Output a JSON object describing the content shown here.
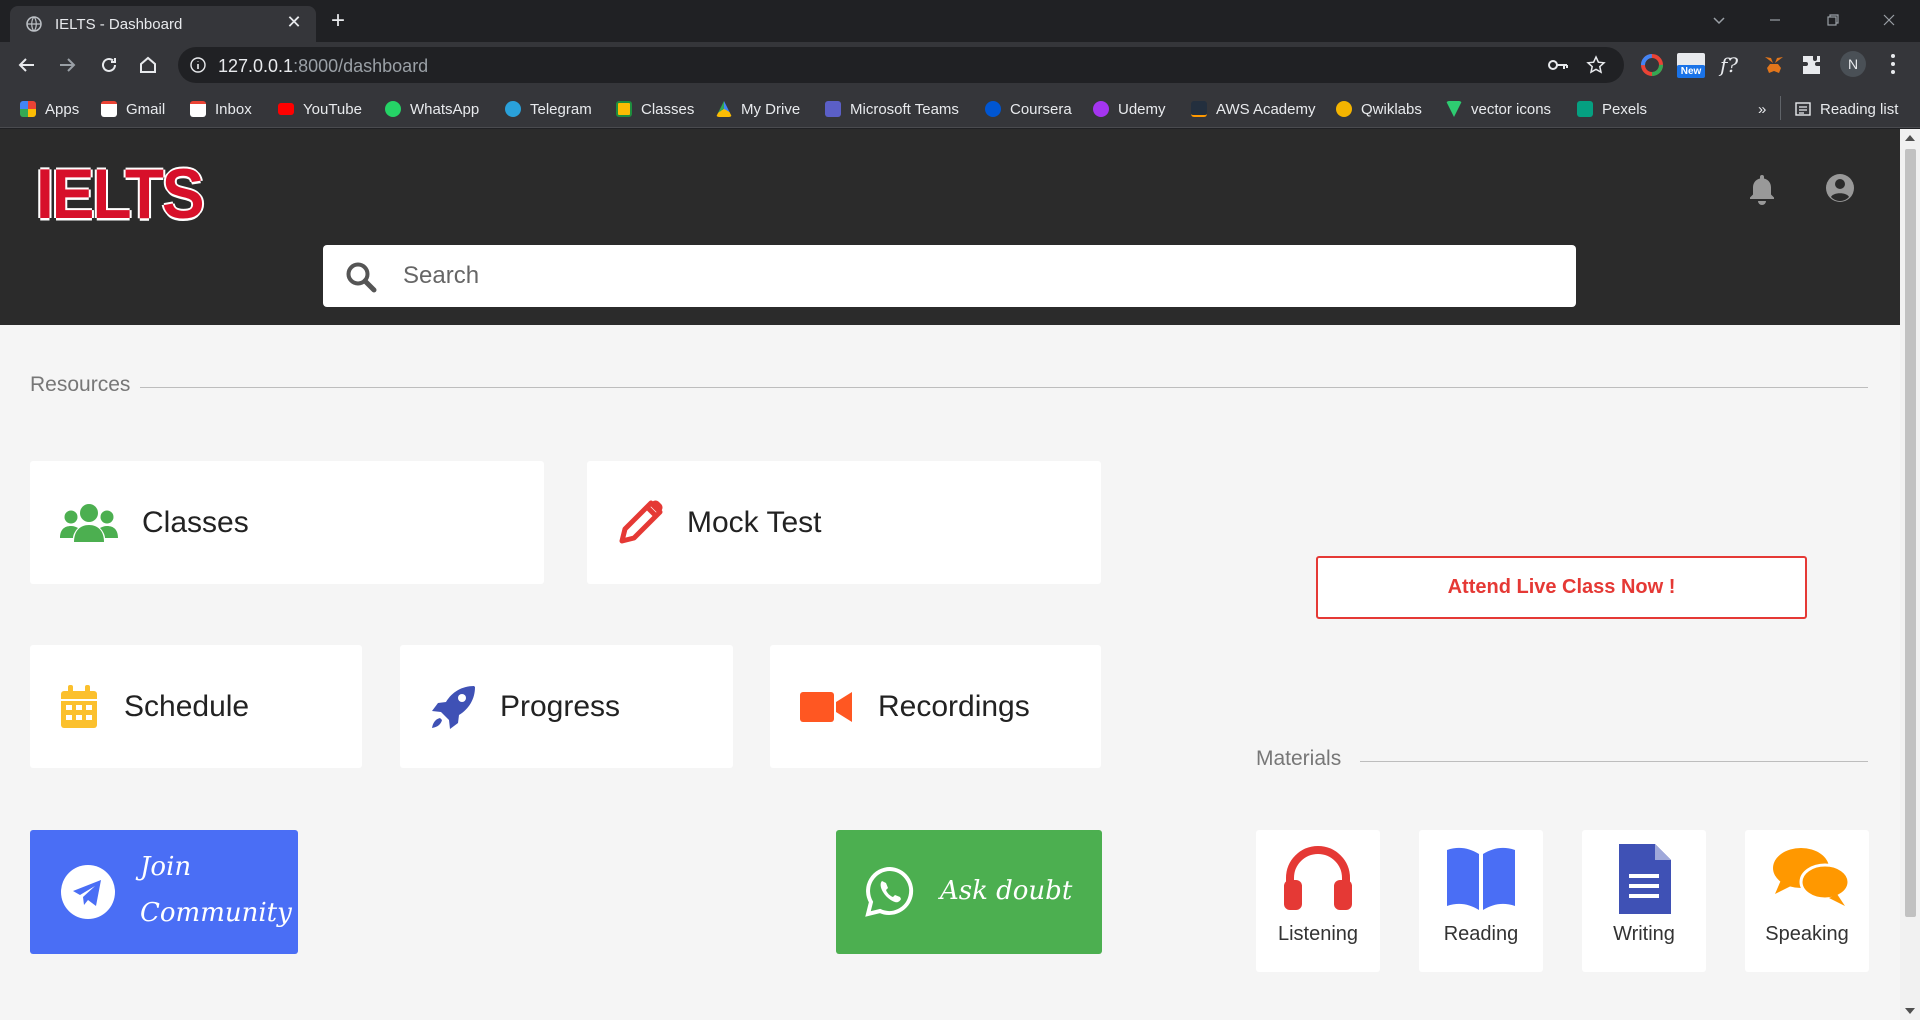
{
  "browser": {
    "tab_title": "IELTS - Dashboard",
    "url_host": "127.0.0.1",
    "url_path": ":8000/dashboard",
    "profile_initial": "N",
    "extension_badge": "New",
    "bookmarks": [
      {
        "label": "Apps",
        "color": "#4285f4"
      },
      {
        "label": "Gmail",
        "color": "#ea4335"
      },
      {
        "label": "Inbox",
        "color": "#ea4335"
      },
      {
        "label": "YouTube",
        "color": "#ff0000"
      },
      {
        "label": "WhatsApp",
        "color": "#25d366"
      },
      {
        "label": "Telegram",
        "color": "#2aa1da"
      },
      {
        "label": "Classes",
        "color": "#1e8e3e"
      },
      {
        "label": "My Drive",
        "color": "#fbbc04"
      },
      {
        "label": "Microsoft Teams",
        "color": "#5b5fc7"
      },
      {
        "label": "Coursera",
        "color": "#0056d2"
      },
      {
        "label": "Udemy",
        "color": "#a435f0"
      },
      {
        "label": "AWS Academy",
        "color": "#232f3e"
      },
      {
        "label": "Qwiklabs",
        "color": "#f4b400"
      },
      {
        "label": "vector icons",
        "color": "#2ecc71"
      },
      {
        "label": "Pexels",
        "color": "#05a081"
      }
    ],
    "overflow_label": "»",
    "reading_list": "Reading list"
  },
  "header": {
    "logo_text": "IELTS",
    "search_placeholder": "Search"
  },
  "resources": {
    "title": "Resources",
    "cards": {
      "classes": "Classes",
      "mock_test": "Mock Test",
      "schedule": "Schedule",
      "progress": "Progress",
      "recordings": "Recordings"
    }
  },
  "live_class": {
    "label": "Attend Live Class Now !"
  },
  "promos": {
    "join_line1": "Join",
    "join_line2": "Community",
    "ask_doubt": "Ask doubt"
  },
  "materials": {
    "title": "Materials",
    "items": {
      "listening": "Listening",
      "reading": "Reading",
      "writing": "Writing",
      "speaking": "Speaking"
    }
  },
  "colors": {
    "brand_red": "#d7102a",
    "classes_green": "#4caf50",
    "mock_red": "#e53935",
    "schedule_yellow": "#fbc02d",
    "progress_indigo": "#3f51b5",
    "recordings_orange": "#ff5722",
    "telegram_blue": "#4a6ef5",
    "whatsapp_green": "#4caf50",
    "speaking_orange": "#ff9800"
  }
}
